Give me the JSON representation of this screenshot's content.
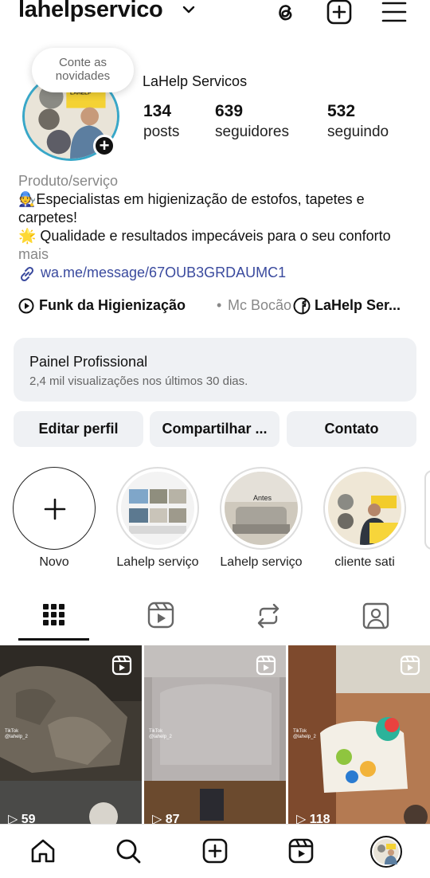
{
  "header": {
    "username": "lahelpservico"
  },
  "profile": {
    "notes_bubble": "Conte as novidades",
    "display_name": "LaHelp Servicos",
    "stats": {
      "posts": {
        "value": "134",
        "label": "posts"
      },
      "followers": {
        "value": "639",
        "label": "seguidores"
      },
      "following": {
        "value": "532",
        "label": "seguindo"
      }
    }
  },
  "bio": {
    "category": "Produto/serviço",
    "line1": "🧑‍🔧Especialistas em higienização de estofos, tapetes e carpetes!",
    "line3": "🌟 Qualidade e resultados impecáveis para o seu conforto",
    "more": "mais",
    "link": "wa.me/message/67OUB3GRDAUMC1"
  },
  "music": {
    "song": "Funk da Higienização",
    "separator": "•",
    "artist": "Mc Bocão",
    "facebook": "LaHelp Ser..."
  },
  "panel": {
    "title": "Painel Profissional",
    "subtitle": "2,4 mil visualizações nos últimos 30 dias."
  },
  "buttons": {
    "edit": "Editar perfil",
    "share": "Compartilhar ...",
    "contact": "Contato"
  },
  "highlights": [
    {
      "label": "Novo"
    },
    {
      "label": "Lahelp serviço"
    },
    {
      "label": "Lahelp serviço"
    },
    {
      "label": "cliente sati"
    }
  ],
  "grid": [
    {
      "views": "59",
      "tiktok": "TikTok",
      "handle": "@lahelp_2"
    },
    {
      "views": "87",
      "tiktok": "TikTok",
      "handle": "@lahelp_2"
    },
    {
      "views": "118",
      "tiktok": "TikTok",
      "handle": "@lahelp_2"
    }
  ],
  "highlight_texts": {
    "antes": "Antes"
  },
  "colors": {
    "link": "#3a4a9e",
    "avatar_ring": "#38a7c8",
    "panel_bg": "#eff1f4"
  }
}
